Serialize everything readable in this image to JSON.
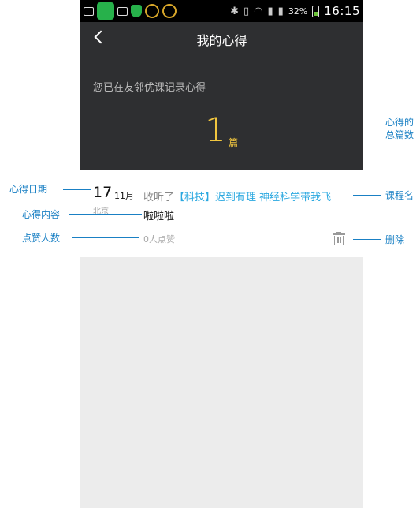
{
  "status_bar": {
    "battery": "32%",
    "time": "16:15"
  },
  "header": {
    "title": "我的心得",
    "subtitle": "您已在友邻优课记录心得",
    "count": "1",
    "count_unit": "篇"
  },
  "entry": {
    "day": "17",
    "month": "11月",
    "city": "北京",
    "course_prefix": "收听了",
    "course_title": "【科技】迟到有理 神经科学带我飞",
    "content": "啦啦啦",
    "likes": "0人点赞"
  },
  "annotations": {
    "count_label_line1": "心得的",
    "count_label_line2": "总篇数",
    "date": "心得日期",
    "content": "心得内容",
    "likes": "点赞人数",
    "course": "课程名",
    "delete": "删除"
  },
  "colors": {
    "header_bg": "#2e2f31",
    "accent_yellow": "#f1c63f",
    "link_blue": "#2aa8e0",
    "annotation_blue": "#1a80c4"
  }
}
